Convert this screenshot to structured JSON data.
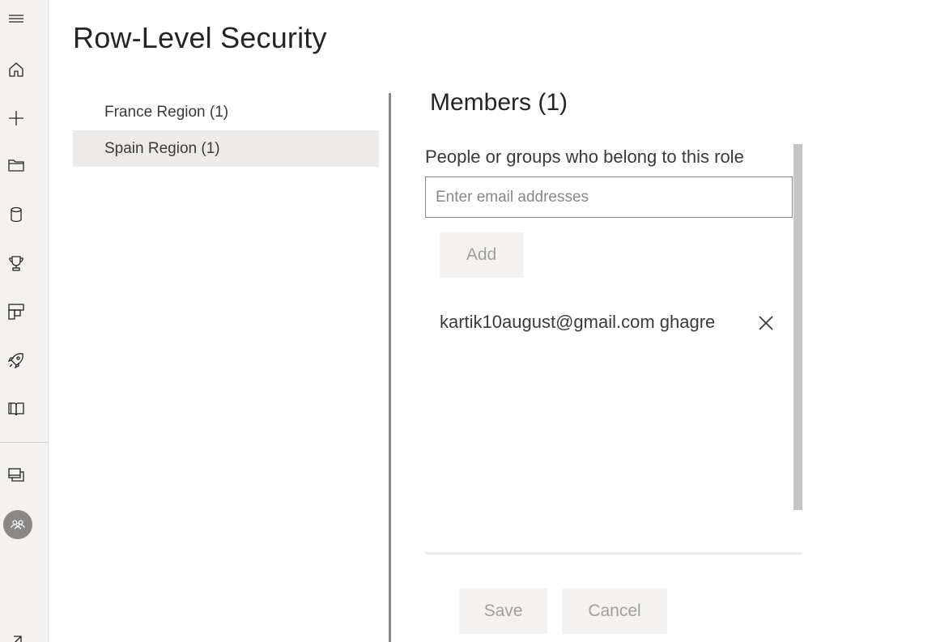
{
  "nav": {
    "items": [
      {
        "icon": "hamburger-icon"
      },
      {
        "icon": "home-icon"
      },
      {
        "icon": "plus-icon"
      },
      {
        "icon": "folder-icon"
      },
      {
        "icon": "datasets-icon"
      },
      {
        "icon": "trophy-icon"
      },
      {
        "icon": "apps-icon"
      },
      {
        "icon": "rocket-icon"
      },
      {
        "icon": "book-icon"
      },
      {
        "icon": "workspaces-icon"
      },
      {
        "icon": "people-icon"
      },
      {
        "icon": "expand-icon"
      }
    ]
  },
  "page": {
    "title": "Row-Level Security"
  },
  "roles": [
    {
      "label": "France Region (1)",
      "selected": false
    },
    {
      "label": "Spain Region (1)",
      "selected": true
    }
  ],
  "members": {
    "title": "Members (1)",
    "label": "People or groups who belong to this role",
    "input_placeholder": "Enter email addresses",
    "input_value": "",
    "add_label": "Add",
    "list": [
      {
        "name": "kartik10august@gmail.com ghagre"
      }
    ]
  },
  "actions": {
    "save_label": "Save",
    "cancel_label": "Cancel"
  }
}
